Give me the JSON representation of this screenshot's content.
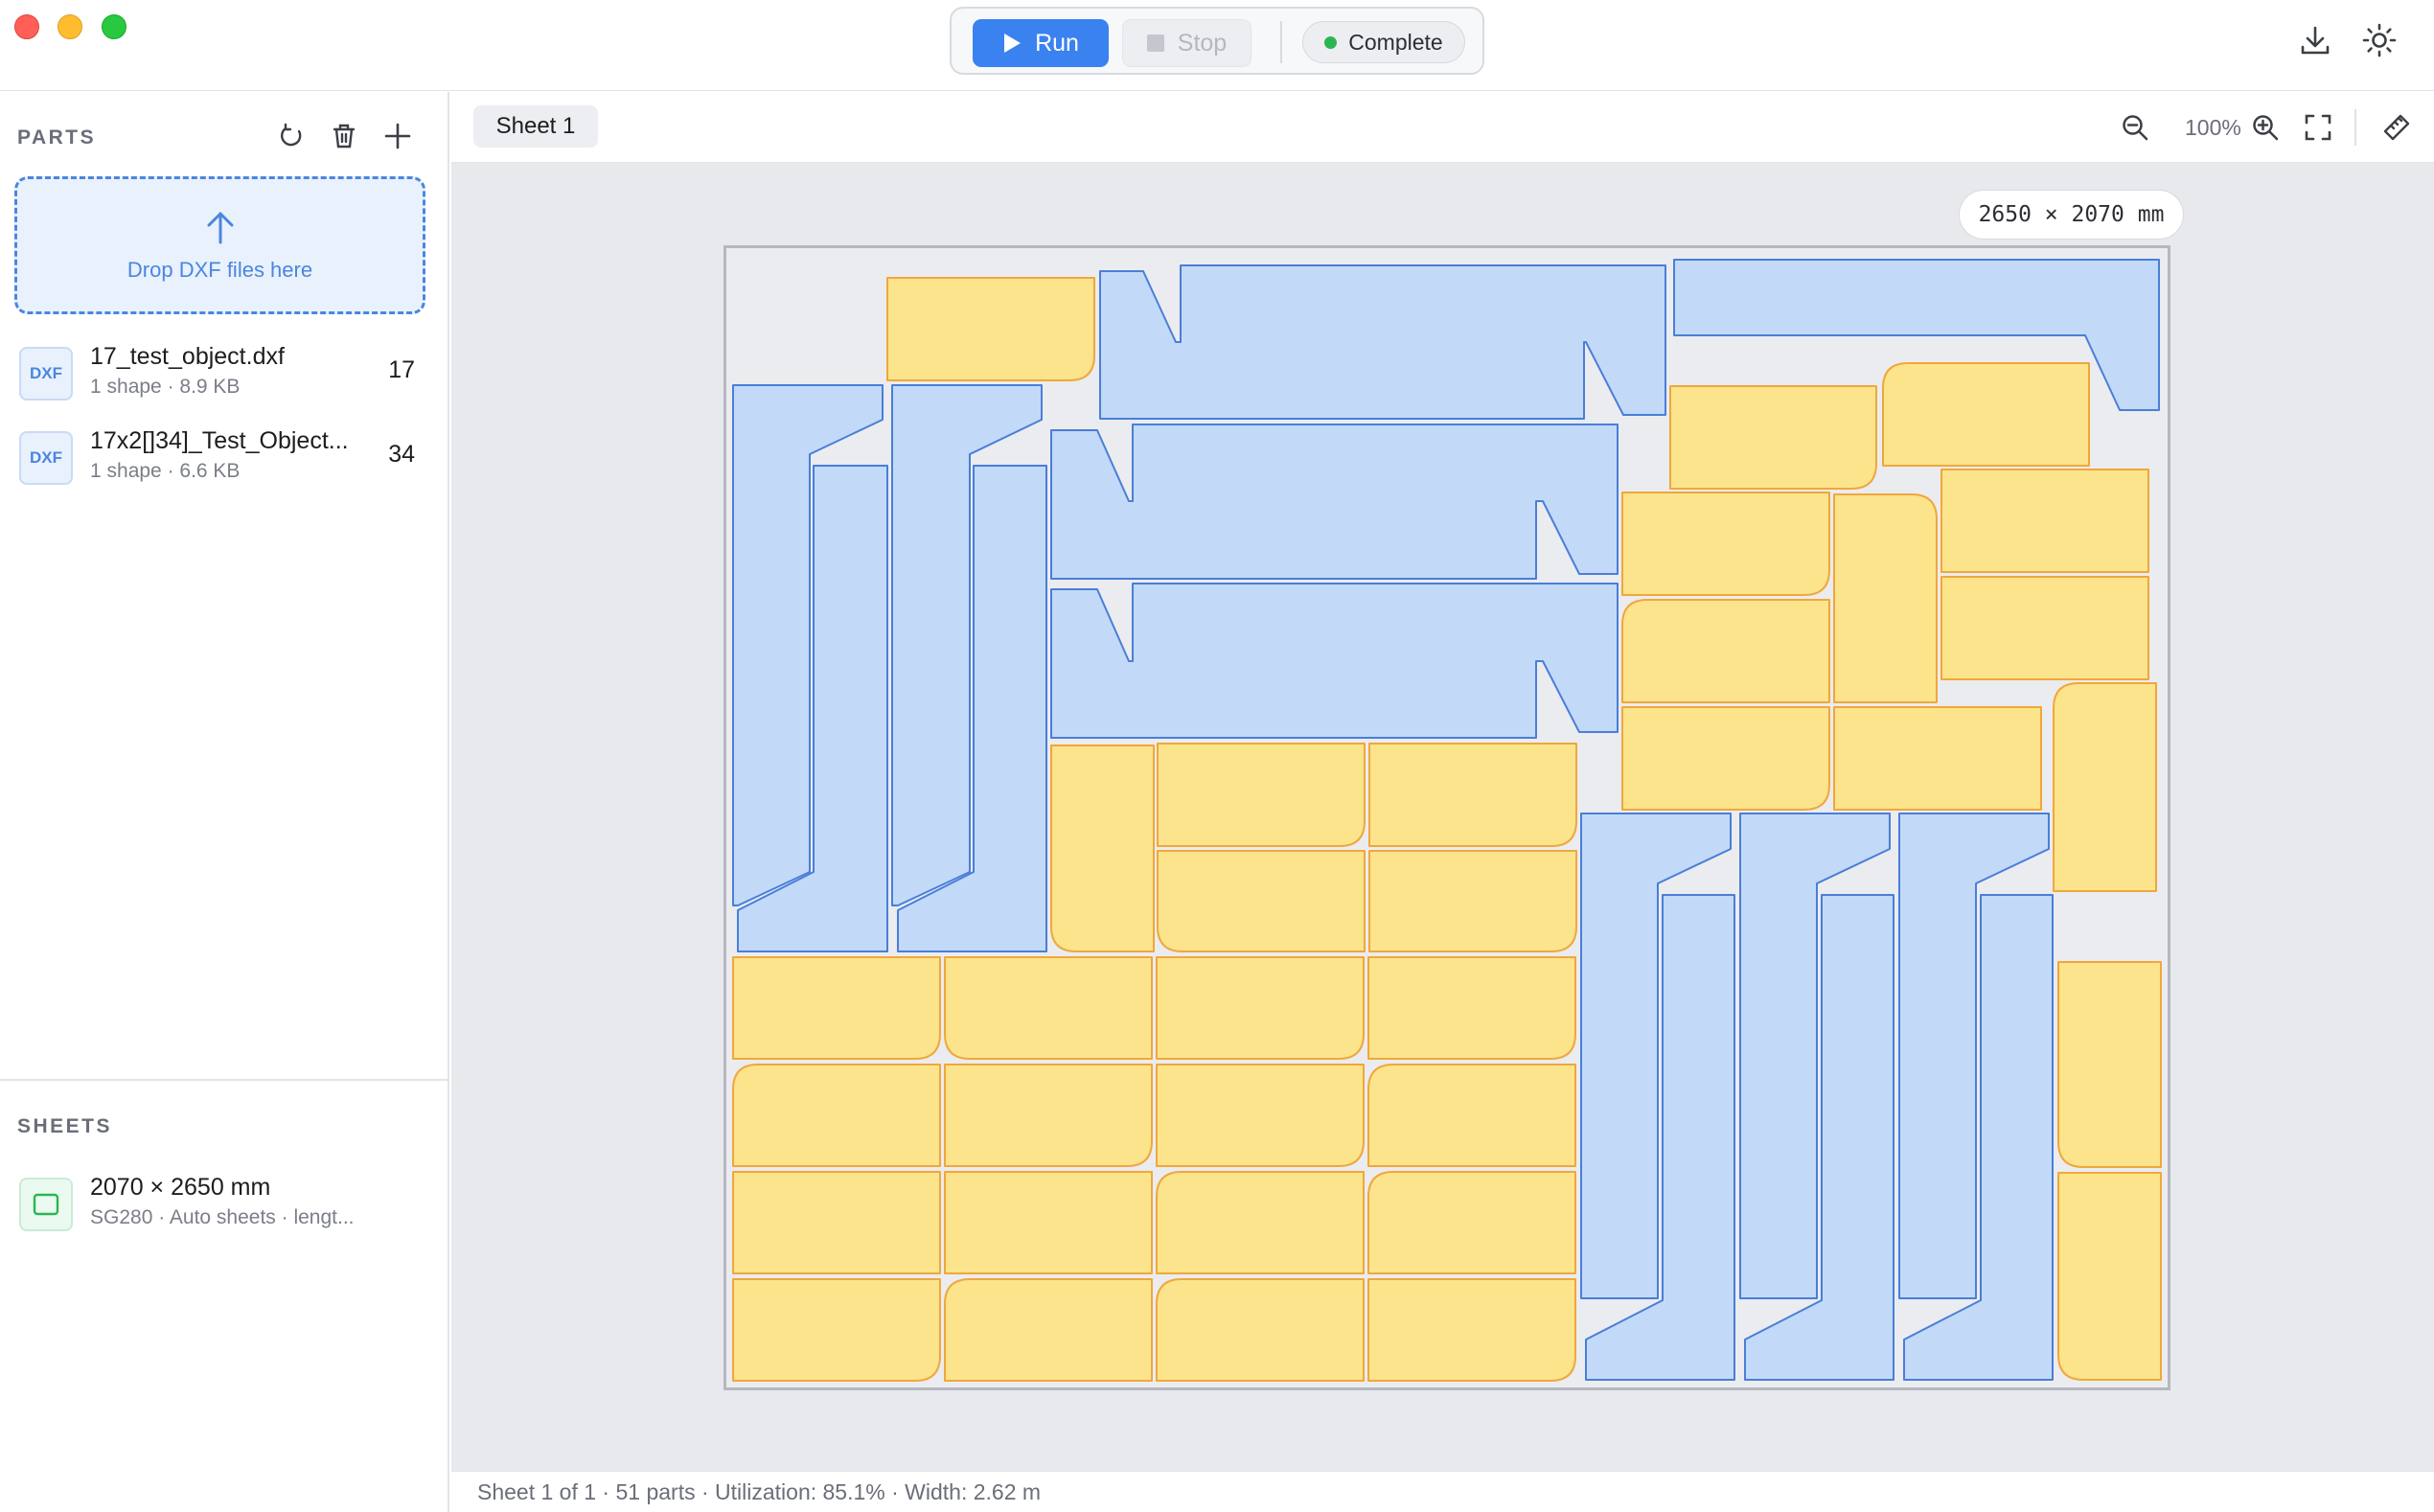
{
  "toolbar": {
    "run_label": "Run",
    "stop_label": "Stop",
    "status_label": "Complete",
    "status_color": "#2db552",
    "accent_color": "#3a82f0"
  },
  "top_icons": [
    "download-icon",
    "brightness-icon"
  ],
  "sidebar": {
    "parts_label": "PARTS",
    "part_actions": [
      "reset-icon",
      "trash-icon",
      "plus-icon"
    ],
    "dropzone_text": "Drop DXF files here",
    "files": [
      {
        "badge": "DXF",
        "name": "17_test_object.dxf",
        "meta": "1 shape · 8.9 KB",
        "count": "17"
      },
      {
        "badge": "DXF",
        "name": "17x2[]34]_Test_Object...",
        "meta": "1 shape · 6.6 KB",
        "count": "34"
      }
    ],
    "sheets_label": "SHEETS",
    "sheets": [
      {
        "name": "2070 × 2650 mm",
        "meta": "SG280 · Auto sheets · lengt..."
      }
    ]
  },
  "main": {
    "tab_label": "Sheet 1",
    "zoom_level": "100%",
    "dimension_label": "2650 × 2070 mm",
    "view_icons": [
      "zoom-out-icon",
      "zoom-in-icon",
      "fit-screen-icon",
      "ruler-icon"
    ]
  },
  "nest_view": {
    "part_colors": {
      "blue_fill": "#c2daf8",
      "blue_stroke": "#4a7ed8",
      "yellow_fill": "#fbe48c",
      "yellow_stroke": "#f0a73c"
    },
    "blue_part_count": 17,
    "yellow_part_count": 34
  },
  "statusbar": {
    "text": "Sheet 1 of 1 · 51 parts · Utilization: 85.1% · Width: 2.62 m"
  }
}
